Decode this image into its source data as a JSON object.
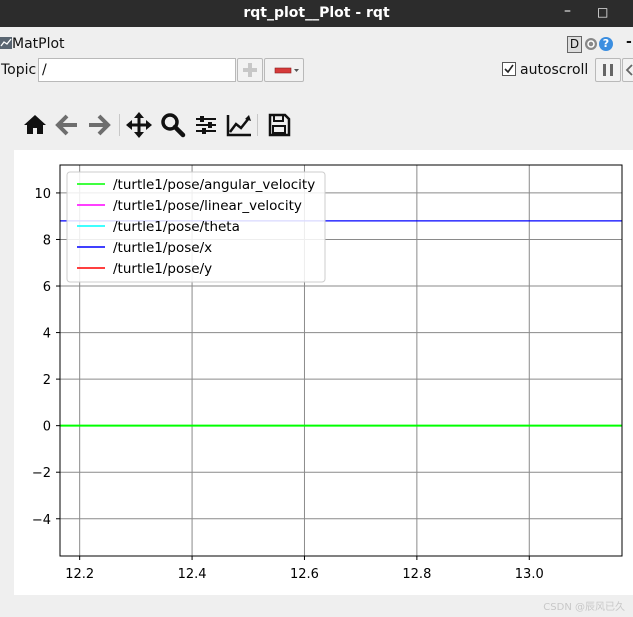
{
  "window": {
    "title": "rqt_plot__Plot - rqt",
    "minimize": "–",
    "maximize": "□",
    "close": "✕"
  },
  "plugin": {
    "name": "MatPlot",
    "d_label": "D",
    "help_label": "?",
    "dash": "-"
  },
  "topic": {
    "label": "Topic",
    "value": "/",
    "autoscroll_label": "autoscroll",
    "autoscroll_checked": true
  },
  "toolbar": {
    "icons": [
      "home-icon",
      "back-arrow-icon",
      "forward-arrow-icon",
      "pan-icon",
      "zoom-icon",
      "subplots-config-icon",
      "edit-curve-icon",
      "save-icon"
    ]
  },
  "chart_data": {
    "type": "line",
    "xlim": [
      12.165,
      13.165
    ],
    "ylim": [
      -5.6,
      11.2
    ],
    "x_ticks": [
      12.2,
      12.4,
      12.6,
      12.8,
      13.0
    ],
    "x_tick_labels": [
      "12.2",
      "12.4",
      "12.6",
      "12.8",
      "13.0"
    ],
    "y_ticks": [
      -4,
      -2,
      0,
      2,
      4,
      6,
      8,
      10
    ],
    "y_tick_labels": [
      "−4",
      "−2",
      "0",
      "2",
      "4",
      "6",
      "8",
      "10"
    ],
    "grid": true,
    "legend_position": "upper-left",
    "series": [
      {
        "name": "/turtle1/pose/angular_velocity",
        "color": "#00ff00",
        "x": [
          12.165,
          13.165
        ],
        "y": [
          0,
          0
        ]
      },
      {
        "name": "/turtle1/pose/linear_velocity",
        "color": "#ff00ff",
        "x": [
          12.165,
          13.165
        ],
        "y": [
          0,
          0
        ]
      },
      {
        "name": "/turtle1/pose/theta",
        "color": "#00ffff",
        "x": [
          12.165,
          13.165
        ],
        "y": [
          0,
          0
        ]
      },
      {
        "name": "/turtle1/pose/x",
        "color": "#0000ff",
        "x": [
          12.165,
          13.165
        ],
        "y": [
          8.8,
          8.8
        ]
      },
      {
        "name": "/turtle1/pose/y",
        "color": "#ff0000",
        "x": [
          12.165,
          13.165
        ],
        "y": [
          0,
          0
        ]
      }
    ]
  },
  "credit": "CSDN @辰风已久"
}
